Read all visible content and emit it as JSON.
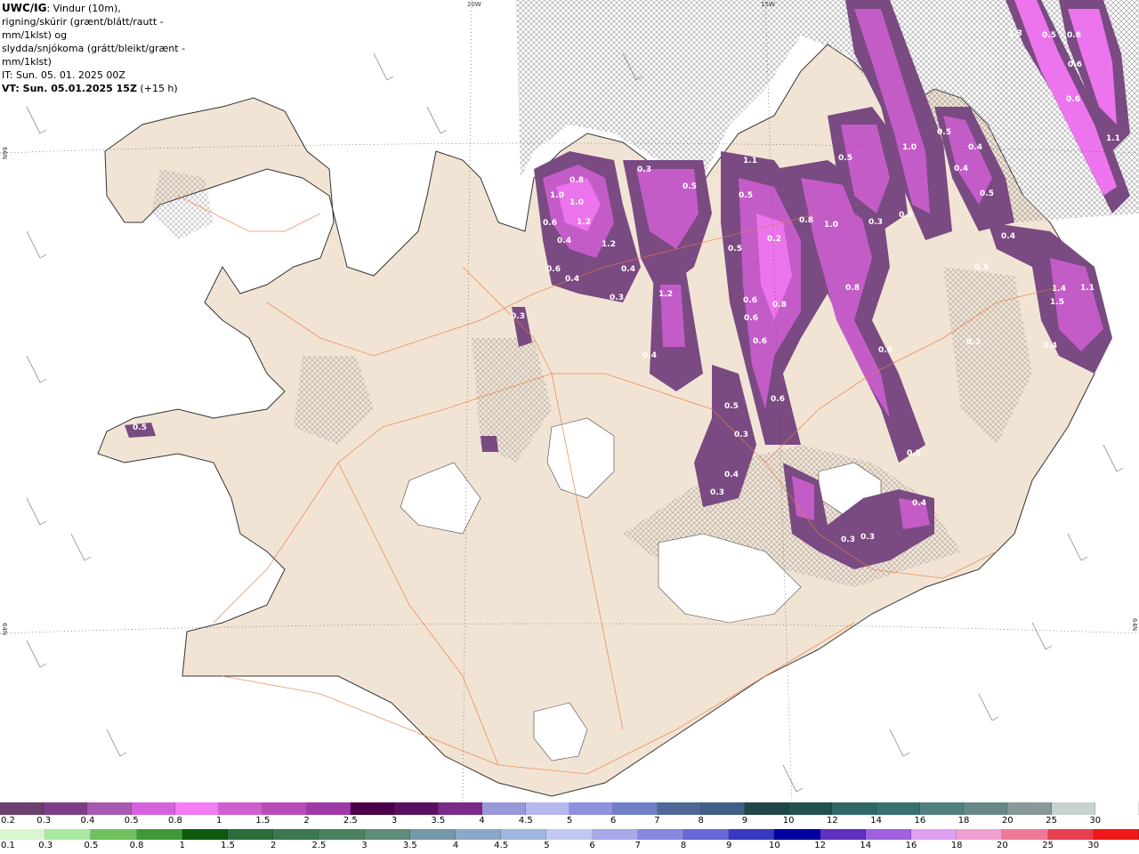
{
  "header": {
    "title_bold": "UWC/IG",
    "title_rest": ": Vindur (10m),",
    "line2": "rigning/skúrir (grænt/blátt/rautt - mm/1klst) og",
    "line3": "slydda/snjókoma (grátt/bleikt/grænt - mm/1klst)",
    "line4": "IT: Sun. 05. 01. 2025 00Z",
    "line5": "VT: Sun. 05.01.2025 15Z",
    "line5_suffix": " (+15 h)"
  },
  "coords": {
    "lon_20w": "20W",
    "lon_15w": "15W",
    "lat_66n_left": "66N",
    "lat_64n_left": "64N",
    "lat_64n_right": "64N"
  },
  "map_values": [
    "0.5",
    "0.8",
    "1.0",
    "1.0",
    "0.6",
    "0.4",
    "1.2",
    "0.6",
    "1.2",
    "0.4",
    "0.4",
    "0.3",
    "1.2",
    "0.4",
    "0.3",
    "0.3",
    "0.5",
    "1.1",
    "0.5",
    "0.5",
    "0.8",
    "1.0",
    "0.5",
    "0.3",
    "0.8",
    "0.6",
    "0.6",
    "0.6",
    "0.8",
    "0.3",
    "0.6",
    "0.5",
    "0.3",
    "0.4",
    "0.3",
    "0.3",
    "0.3",
    "0.4",
    "0.5",
    "1.0",
    "0.4",
    "0.4",
    "0.5",
    "0.4",
    "0.5",
    "1.4",
    "1.1",
    "1.5",
    "0.4",
    "0.2",
    "1.3",
    "0.5",
    "0.6",
    "0.6",
    "0.6",
    "1.1",
    "0.5",
    "0.3",
    "0.2",
    "0.5"
  ],
  "legend": {
    "snow": {
      "labels": [
        "0.2",
        "0.3",
        "0.4",
        "0.5",
        "0.8",
        "1",
        "1.5",
        "2",
        "2.5",
        "3",
        "3.5",
        "4",
        "4.5",
        "5",
        "6",
        "7",
        "8",
        "9",
        "10",
        "12",
        "14",
        "16",
        "18",
        "20",
        "25",
        "30"
      ],
      "colors": [
        "#6b3f6e",
        "#7e3d88",
        "#a65ab2",
        "#d760dc",
        "#f47cf4",
        "#cf5fcf",
        "#b84cb8",
        "#a039a8",
        "#4a0048",
        "#5a1060",
        "#7a2a88",
        "#9898d8",
        "#b8b8f0",
        "#9090e0",
        "#7080c8",
        "#506898",
        "#406088",
        "#204848",
        "#205050",
        "#306868",
        "#387070",
        "#508080",
        "#688888",
        "#889898",
        "#c8d0d0",
        "#ffffff"
      ]
    },
    "rain": {
      "labels": [
        "0.1",
        "0.3",
        "0.5",
        "0.8",
        "1",
        "1.5",
        "2",
        "2.5",
        "3",
        "3.5",
        "4",
        "4.5",
        "5",
        "6",
        "7",
        "8",
        "9",
        "10",
        "12",
        "14",
        "16",
        "18",
        "20",
        "25",
        "30"
      ],
      "colors": [
        "#d8f5d0",
        "#a8e8a0",
        "#70c060",
        "#409838",
        "#0f5a0f",
        "#2c6c3c",
        "#3c7850",
        "#4a8260",
        "#5e8c78",
        "#7498a8",
        "#8aa8c8",
        "#a0b8e0",
        "#c0c8f0",
        "#a8a8e8",
        "#8888e0",
        "#6868d8",
        "#3838c0",
        "#0000a0",
        "#6030c0",
        "#a060e0",
        "#e0a0f0",
        "#f0a0d0",
        "#f07898",
        "#e84050",
        "#f01818"
      ]
    }
  }
}
